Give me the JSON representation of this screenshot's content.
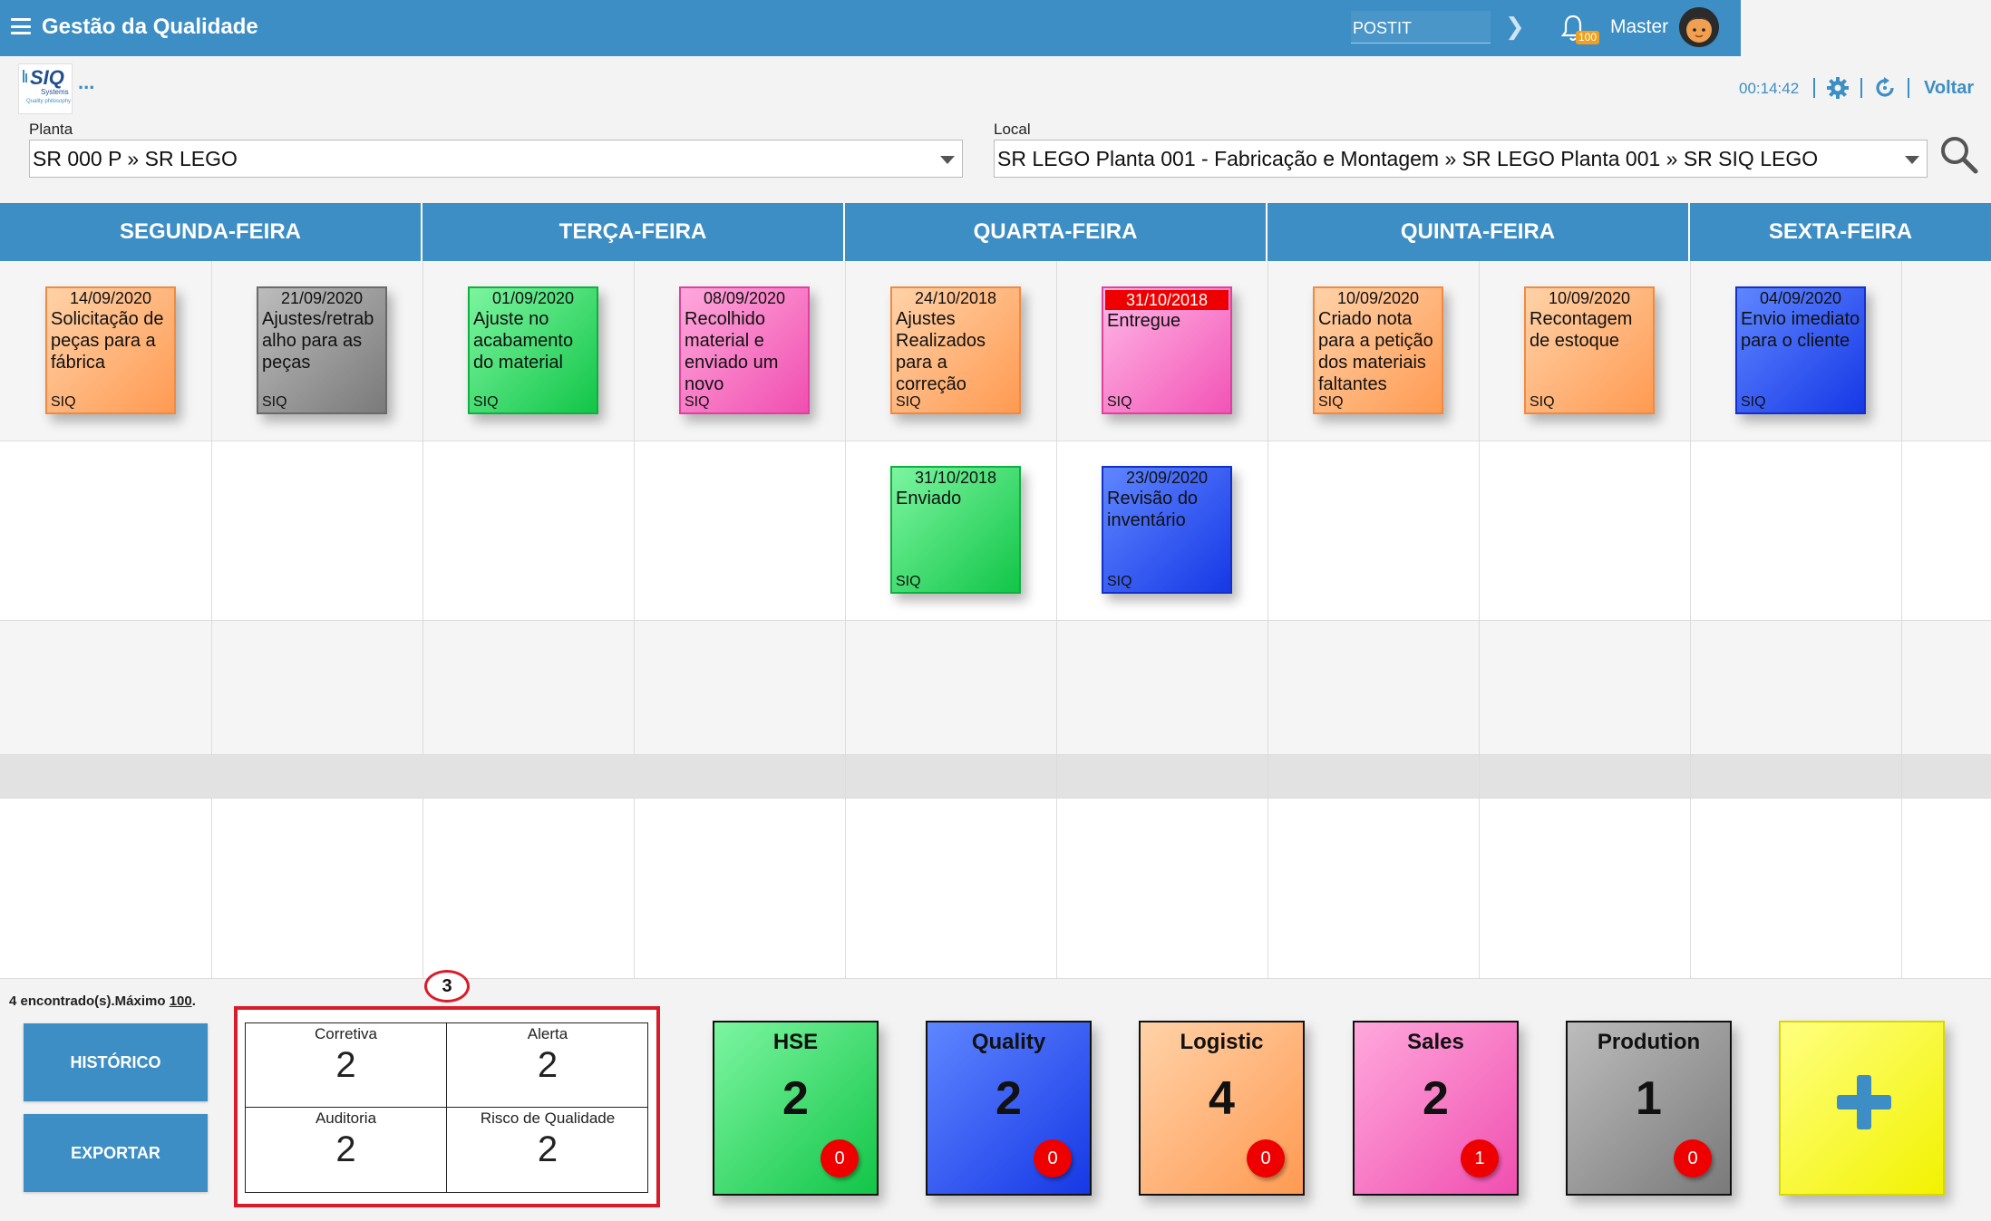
{
  "header": {
    "app_title": "Gestão da Qualidade",
    "search_value": "POSTIT",
    "notification_count": "100",
    "user_name": "Master"
  },
  "toolbar": {
    "logo_text": "SIQ",
    "logo_subtext": "Systems",
    "logo_tagline": "Quality philosophy",
    "more": "...",
    "clock": "00:14:42",
    "back_label": "Voltar"
  },
  "filters": {
    "plant_label": "Planta",
    "plant_value": "SR 000 P » SR LEGO",
    "local_label": "Local",
    "local_value": "SR LEGO Planta 001 - Fabricação e Montagem » SR LEGO Planta 001 » SR SIQ LEGO"
  },
  "board": {
    "days": [
      "SEGUNDA-FEIRA",
      "TERÇA-FEIRA",
      "QUARTA-FEIRA",
      "QUINTA-FEIRA",
      "SEXTA-FEIRA"
    ],
    "notes": [
      {
        "date": "14/09/2020",
        "text": "Solicitação de peças para a fábrica",
        "tag": "SIQ",
        "color": "orange",
        "overdue": false
      },
      {
        "date": "21/09/2020",
        "text": "Ajustes/retrab alho para as peças",
        "tag": "SIQ",
        "color": "gray",
        "overdue": false
      },
      {
        "date": "01/09/2020",
        "text": "Ajuste no acabamento do material",
        "tag": "SIQ",
        "color": "green",
        "overdue": false
      },
      {
        "date": "08/09/2020",
        "text": "Recolhido material e enviado um novo",
        "tag": "SIQ",
        "color": "pink",
        "overdue": false
      },
      {
        "date": "24/10/2018",
        "text": "Ajustes Realizados para a correção",
        "tag": "SIQ",
        "color": "orange",
        "overdue": false
      },
      {
        "date": "31/10/2018",
        "text": "Entregue",
        "tag": "SIQ",
        "color": "pinkred",
        "overdue": true
      },
      {
        "date": "10/09/2020",
        "text": "Criado nota para a petição dos materiais faltantes",
        "tag": "SIQ",
        "color": "orange",
        "overdue": false
      },
      {
        "date": "10/09/2020",
        "text": "Recontagem de estoque",
        "tag": "SIQ",
        "color": "orange",
        "overdue": false
      },
      {
        "date": "04/09/2020",
        "text": "Envio imediato para o cliente",
        "tag": "SIQ",
        "color": "blue",
        "overdue": false
      },
      {
        "date": "31/10/2018",
        "text": "Enviado",
        "tag": "SIQ",
        "color": "green",
        "overdue": false
      },
      {
        "date": "23/09/2020",
        "text": "Revisão do inventário",
        "tag": "SIQ",
        "color": "blue",
        "overdue": false
      }
    ]
  },
  "footer": {
    "found_prefix": "4 encontrado(s).Máximo ",
    "found_max": "100",
    "found_suffix": ".",
    "history_label": "HISTÓRICO",
    "export_label": "EXPORTAR",
    "marker": "3",
    "summary": [
      {
        "label": "Corretiva",
        "value": "2"
      },
      {
        "label": "Alerta",
        "value": "2"
      },
      {
        "label": "Auditoria",
        "value": "2"
      },
      {
        "label": "Risco de Qualidade",
        "value": "2"
      }
    ],
    "categories": [
      {
        "name": "HSE",
        "count": "2",
        "badge": "0",
        "color": "green"
      },
      {
        "name": "Quality",
        "count": "2",
        "badge": "0",
        "color": "blue"
      },
      {
        "name": "Logistic",
        "count": "4",
        "badge": "0",
        "color": "orange"
      },
      {
        "name": "Sales",
        "count": "2",
        "badge": "1",
        "color": "pink"
      },
      {
        "name": "Prodution",
        "count": "1",
        "badge": "0",
        "color": "gray"
      }
    ]
  }
}
